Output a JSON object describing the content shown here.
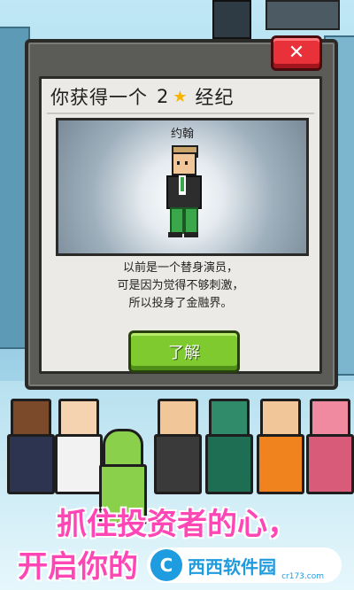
{
  "popup": {
    "title_prefix": "你获得一个",
    "star_count": "2",
    "title_suffix": "经纪",
    "agent_name": "约翰",
    "description": [
      "以前是一个替身演员，",
      "可是因为觉得不够刺激，",
      "所以投身了金融界。"
    ],
    "confirm_label": "了解",
    "close_label": "✕"
  },
  "promo": {
    "line1": "抓住投资者的心，",
    "line2": "开启你的"
  },
  "watermark": {
    "brand": "西西软件园",
    "url": "cr173.com"
  },
  "colors": {
    "close_red": "#e9313a",
    "confirm_green": "#7fcb2f",
    "star_gold": "#f4b400",
    "slogan_pink": "#ff46b5"
  }
}
